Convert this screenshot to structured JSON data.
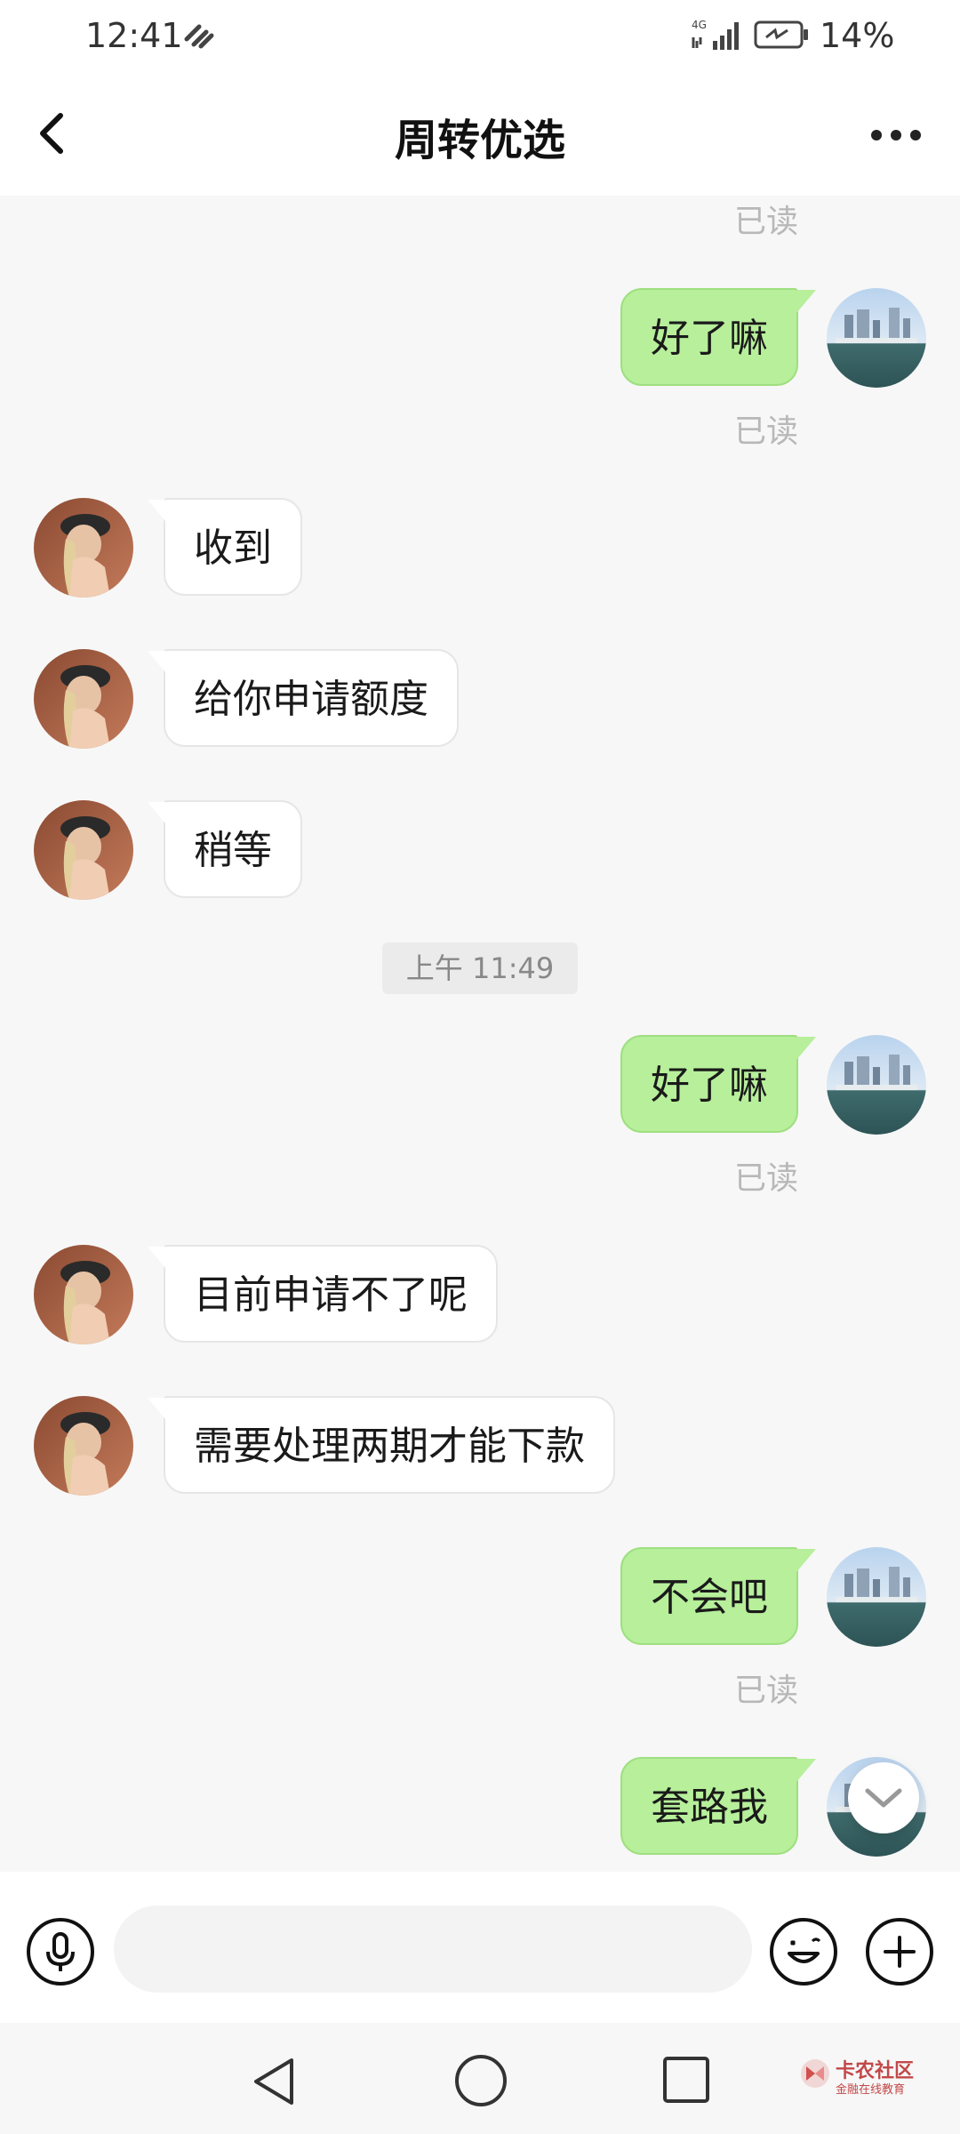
{
  "status_bar": {
    "time": "12:41",
    "network": "4G",
    "battery_percent": "14%"
  },
  "header": {
    "title": "周转优选"
  },
  "chat": {
    "read_label": "已读",
    "timestamp": "上午 11:49",
    "messages": [
      {
        "side": "right",
        "text": "好了嘛"
      },
      {
        "side": "left",
        "text": "收到"
      },
      {
        "side": "left",
        "text": "给你申请额度"
      },
      {
        "side": "left",
        "text": "稍等"
      },
      {
        "side": "right",
        "text": "好了嘛"
      },
      {
        "side": "left",
        "text": "目前申请不了呢"
      },
      {
        "side": "left",
        "text": "需要处理两期才能下款"
      },
      {
        "side": "right",
        "text": "不会吧"
      },
      {
        "side": "right",
        "text": "套路我"
      }
    ]
  },
  "input_bar": {
    "placeholder": ""
  },
  "watermark": {
    "title": "卡农社区",
    "subtitle": "金融在线教育"
  },
  "colors": {
    "sent_bubble": "#b7ef9b",
    "received_bubble": "#ffffff",
    "background": "#f7f7f7"
  }
}
